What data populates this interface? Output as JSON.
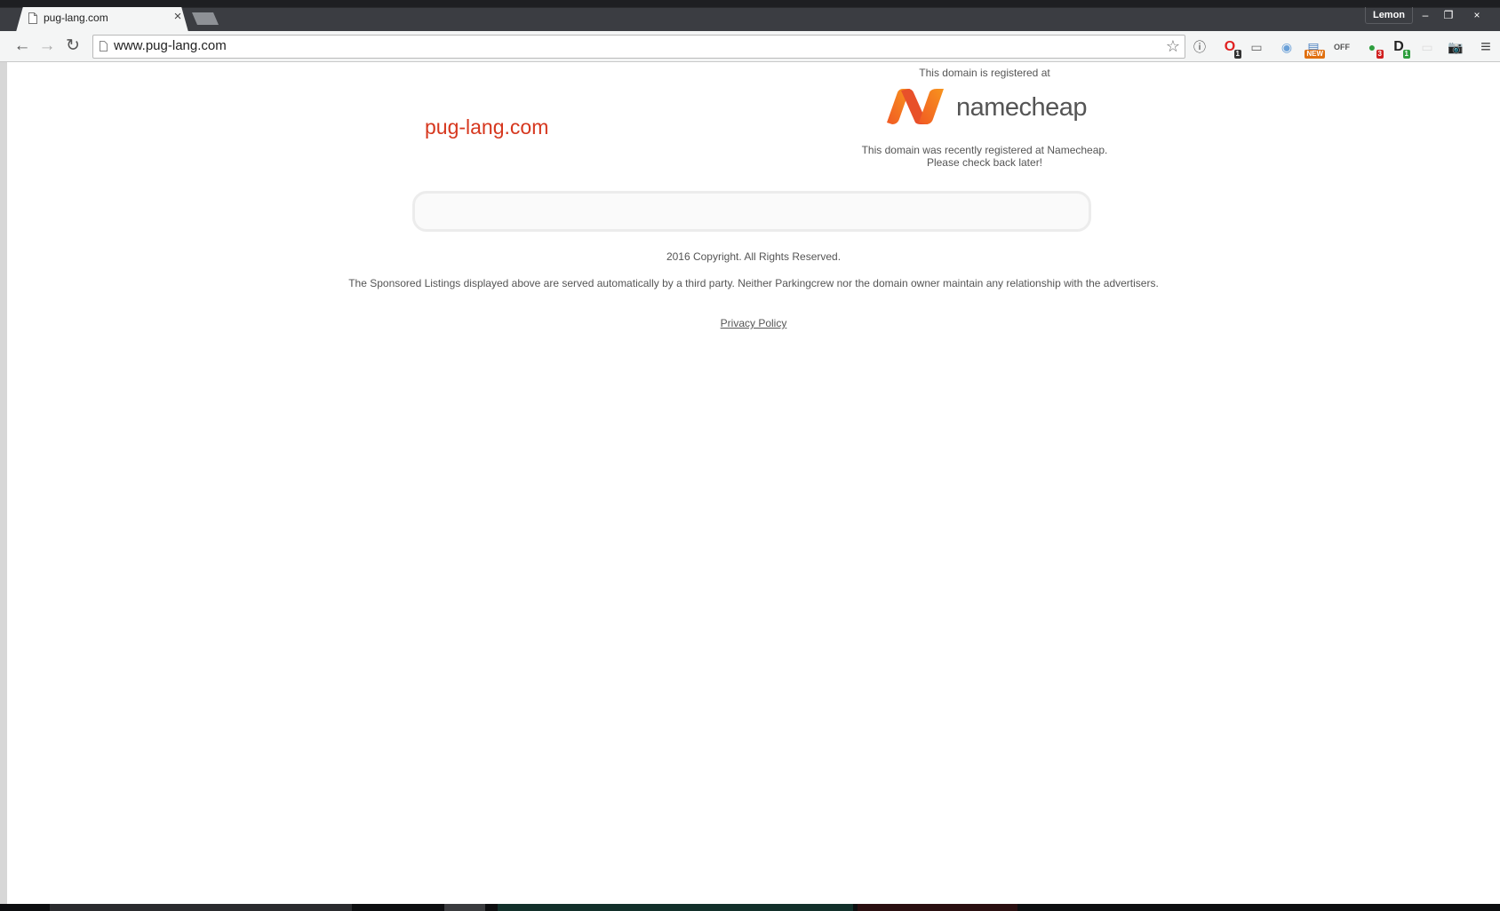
{
  "browser": {
    "tab_title": "pug-lang.com",
    "tab_close_glyph": "×",
    "profile_name": "Lemon",
    "window_buttons": {
      "minimize": "–",
      "restore": "❐",
      "close": "×"
    },
    "url": "www.pug-lang.com",
    "icons": {
      "back": "←",
      "forward": "→",
      "reload": "↻",
      "star": "☆",
      "menu": "≡"
    },
    "extensions": [
      {
        "name": "info-extension-icon",
        "glyph": "ⓘ",
        "color": "#333333",
        "badge": ""
      },
      {
        "name": "opera-extension-icon",
        "glyph": "O",
        "color": "#e02020",
        "badge": "1",
        "badge_color": "#333333"
      },
      {
        "name": "cast-extension-icon",
        "glyph": "▭",
        "color": "#666666",
        "badge": ""
      },
      {
        "name": "camera-extension-icon",
        "glyph": "◉",
        "color": "#6aa0d8",
        "badge": ""
      },
      {
        "name": "news-extension-icon",
        "glyph": "▤",
        "color": "#4a7fc0",
        "badge": "NEW",
        "badge_color": "#e07010"
      },
      {
        "name": "off-extension-icon",
        "glyph": "OFF",
        "color": "#555555",
        "badge": ""
      },
      {
        "name": "green-extension-icon",
        "glyph": "●",
        "color": "#2e9e3e",
        "badge": "3",
        "badge_color": "#d02020"
      },
      {
        "name": "d-extension-icon",
        "glyph": "D",
        "color": "#222222",
        "badge": "1",
        "badge_color": "#2e9e3e"
      },
      {
        "name": "blank-extension-icon",
        "glyph": "▭",
        "color": "#dddddd",
        "badge": ""
      },
      {
        "name": "screenshot-extension-icon",
        "glyph": "📷",
        "color": "#333333",
        "badge": ""
      }
    ]
  },
  "page": {
    "domain_name": "pug-lang.com",
    "registered_at_label": "This domain is registered at",
    "registrar_wordmark": "namecheap",
    "notice_line1": "This domain was recently registered at Namecheap.",
    "notice_line2": "Please check back later!",
    "copyright": "2016 Copyright. All Rights Reserved.",
    "disclaimer": "The Sponsored Listings displayed above are served automatically by a third party. Neither Parkingcrew nor the domain owner maintain any relationship with the advertisers.",
    "privacy_link": "Privacy Policy"
  },
  "colors": {
    "domain_name": "#d6371e",
    "logo_orange": "#f26522",
    "text_gray": "#555555"
  }
}
